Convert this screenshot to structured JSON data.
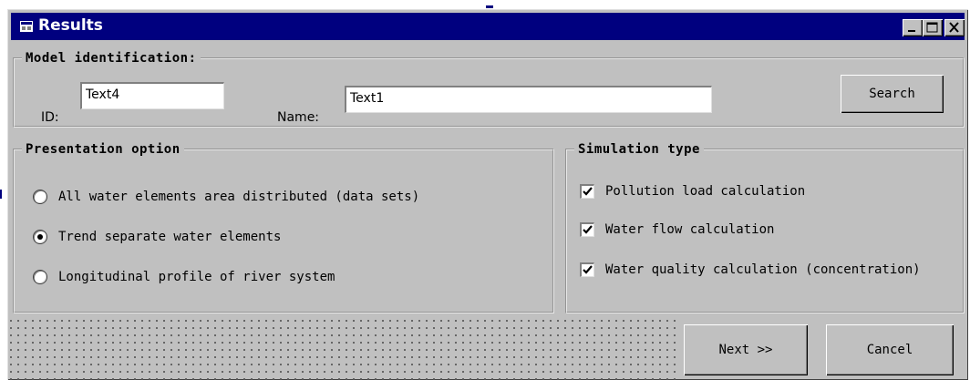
{
  "window": {
    "title": "Results",
    "controls": [
      "minimize-icon",
      "maximize-icon",
      "close-icon"
    ]
  },
  "model_identification": {
    "legend": "Model identification:",
    "id_label": "ID:",
    "id_value": "Text4",
    "name_label": "Name:",
    "name_value": "Text1",
    "search_label": "Search"
  },
  "presentation_option": {
    "legend": "Presentation option",
    "options": [
      {
        "label": "All water elements area distributed (data sets)",
        "selected": false
      },
      {
        "label": "Trend separate water elements",
        "selected": true
      },
      {
        "label": "Longitudinal profile of river system",
        "selected": false
      }
    ]
  },
  "simulation_type": {
    "legend": "Simulation type",
    "options": [
      {
        "label": "Pollution load calculation",
        "checked": true
      },
      {
        "label": "Water flow calculation",
        "checked": true
      },
      {
        "label": "Water quality calculation (concentration)",
        "checked": true
      }
    ]
  },
  "footer": {
    "next_label": "Next >>",
    "cancel_label": "Cancel"
  },
  "colors": {
    "titlebar": "#00007f",
    "face": "#c0c0c0"
  }
}
